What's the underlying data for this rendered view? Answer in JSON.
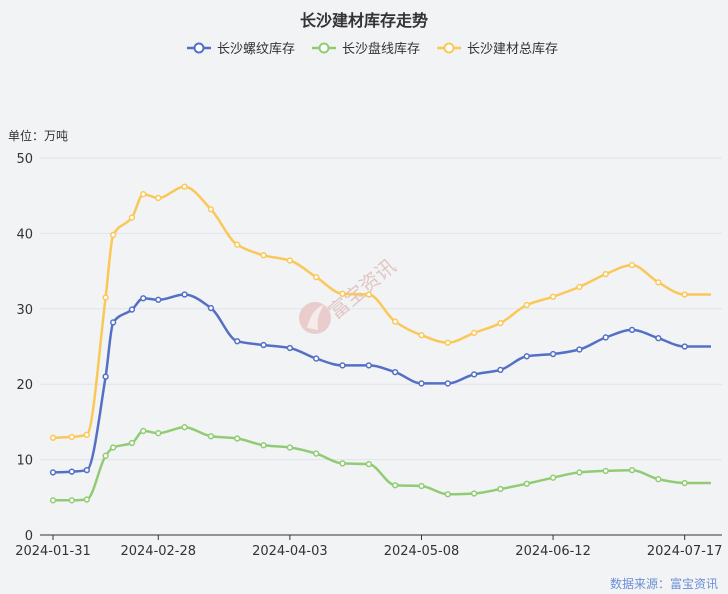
{
  "chart_data": {
    "type": "line",
    "title": "长沙建材库存走势",
    "unit_label": "单位：万吨",
    "source": "数据来源：富宝资讯",
    "watermark": "富宝资讯",
    "ylim": [
      0,
      50
    ],
    "yticks": [
      0,
      10,
      20,
      30,
      40,
      50
    ],
    "x_tick_labels": [
      "2024-01-31",
      "2024-02-28",
      "2024-04-03",
      "2024-05-08",
      "2024-06-12",
      "2024-07-17"
    ],
    "x": [
      "2024-01-31",
      "2024-02-05",
      "2024-02-09",
      "2024-02-14",
      "2024-02-16",
      "2024-02-21",
      "2024-02-24",
      "2024-02-28",
      "2024-03-06",
      "2024-03-13",
      "2024-03-20",
      "2024-03-27",
      "2024-04-03",
      "2024-04-10",
      "2024-04-17",
      "2024-04-24",
      "2024-05-01",
      "2024-05-08",
      "2024-05-15",
      "2024-05-22",
      "2024-05-29",
      "2024-06-05",
      "2024-06-12",
      "2024-06-19",
      "2024-06-26",
      "2024-07-03",
      "2024-07-10",
      "2024-07-17",
      "2024-07-24"
    ],
    "legend_position": "top-center",
    "grid": true,
    "series": [
      {
        "name": "长沙螺纹库存",
        "color": "#5470c6",
        "values": [
          8.3,
          8.4,
          8.6,
          21.0,
          28.2,
          29.9,
          31.4,
          31.2,
          31.9,
          30.1,
          25.7,
          25.2,
          24.8,
          23.4,
          22.5,
          22.5,
          21.6,
          20.1,
          20.1,
          21.3,
          21.9,
          23.7,
          24.0,
          24.6,
          26.2,
          27.2,
          26.1,
          25.0,
          25.0
        ]
      },
      {
        "name": "长沙盘线库存",
        "color": "#91cc75",
        "values": [
          4.6,
          4.6,
          4.7,
          10.5,
          11.6,
          12.2,
          13.8,
          13.5,
          14.3,
          13.1,
          12.8,
          11.9,
          11.6,
          10.8,
          9.5,
          9.4,
          6.6,
          6.5,
          5.4,
          5.5,
          6.1,
          6.8,
          7.6,
          8.3,
          8.5,
          8.6,
          7.4,
          6.9,
          6.9
        ]
      },
      {
        "name": "长沙建材总库存",
        "color": "#fac858",
        "values": [
          12.9,
          13.0,
          13.3,
          31.5,
          39.8,
          42.1,
          45.2,
          44.7,
          46.2,
          43.2,
          38.5,
          37.1,
          36.4,
          34.2,
          32.0,
          31.9,
          28.3,
          26.5,
          25.5,
          26.8,
          28.1,
          30.5,
          31.6,
          32.9,
          34.6,
          35.8,
          33.5,
          31.9,
          31.9
        ]
      }
    ]
  }
}
